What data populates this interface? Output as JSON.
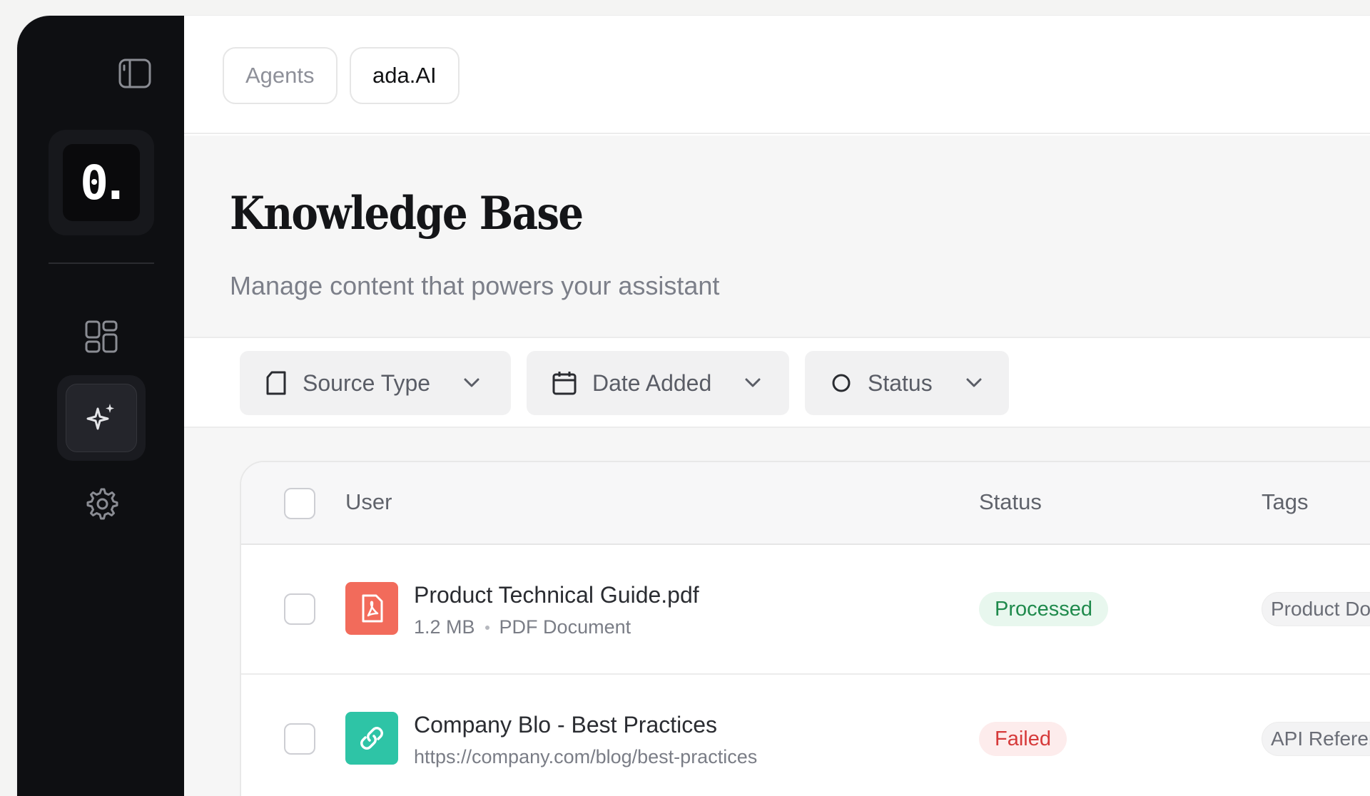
{
  "breadcrumbs": [
    "Agents",
    "ada.AI"
  ],
  "logo": {
    "text": "0."
  },
  "page": {
    "title": "Knowledge Base",
    "subtitle": "Manage content that powers your assistant"
  },
  "filters": [
    {
      "label": "Source Type",
      "icon": "file-icon"
    },
    {
      "label": "Date Added",
      "icon": "calendar-icon"
    },
    {
      "label": "Status",
      "icon": "circle-icon"
    }
  ],
  "table": {
    "columns": [
      "User",
      "Status",
      "Tags"
    ],
    "rows": [
      {
        "name": "Product Technical Guide.pdf",
        "size": "1.2 MB",
        "type": "PDF Document",
        "status": "Processed",
        "tag": "Product Doc",
        "icon": "pdf-icon",
        "icon_color": "#f26b5b"
      },
      {
        "name": "Company Blo - Best Practices",
        "url": "https://company.com/blog/best-practices",
        "status": "Failed",
        "tag": "API Referenc",
        "icon": "link-icon",
        "icon_color": "#2ec4a6"
      }
    ]
  },
  "colors": {
    "sidebar_bg": "#0e0f12",
    "processed_bg": "#e8f7ee",
    "processed_text": "#1f8a4c",
    "failed_bg": "#fdecec",
    "failed_text": "#d63a3a"
  }
}
